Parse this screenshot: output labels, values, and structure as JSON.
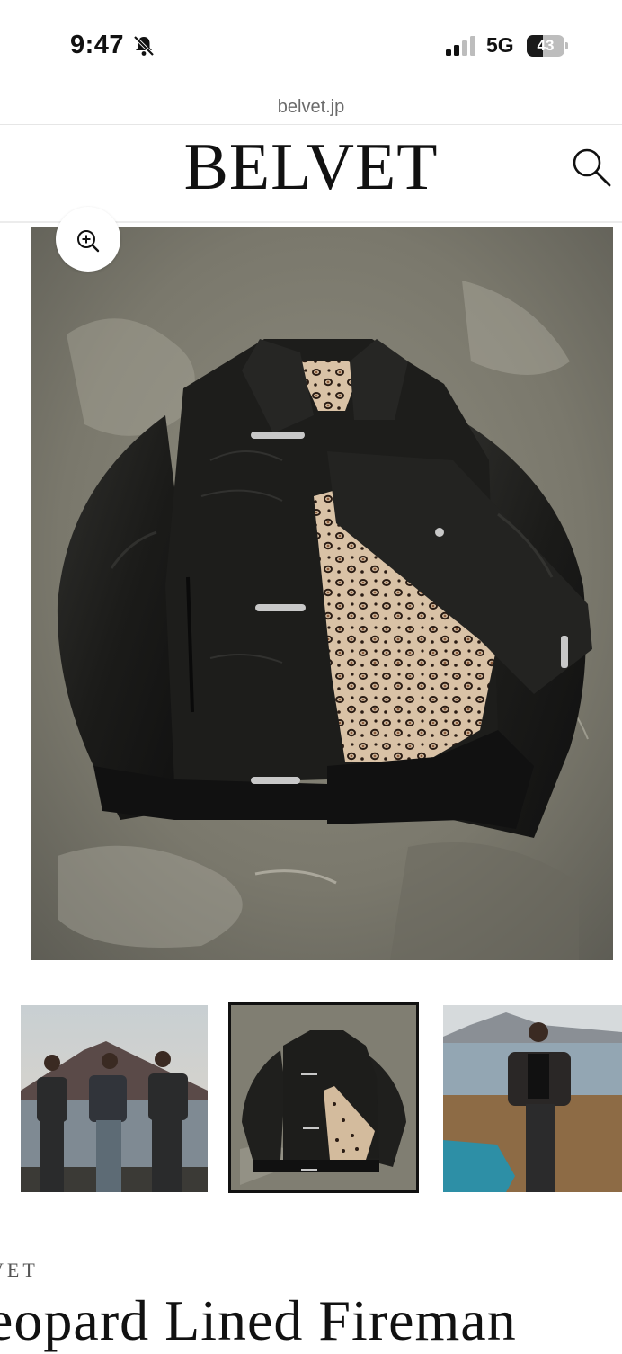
{
  "status_bar": {
    "time": "9:47",
    "network": "5G",
    "battery": "43",
    "battery_level": 0.43
  },
  "browser": {
    "url": "belvet.jp"
  },
  "header": {
    "logo": "BELVET"
  },
  "product": {
    "brand": "VET",
    "title": "eopard Lined Fireman",
    "selected_thumbnail": 2,
    "thumbnails": [
      "group-lakeside-photo",
      "jacket-flatlay-photo",
      "man-lakeside-photo"
    ]
  },
  "icons": {
    "bell": "bell-slash-icon",
    "search": "search-icon",
    "zoom": "zoom-in-icon"
  },
  "colors": {
    "background": "#ffffff",
    "text": "#111111",
    "url": "#6b6b6b"
  }
}
